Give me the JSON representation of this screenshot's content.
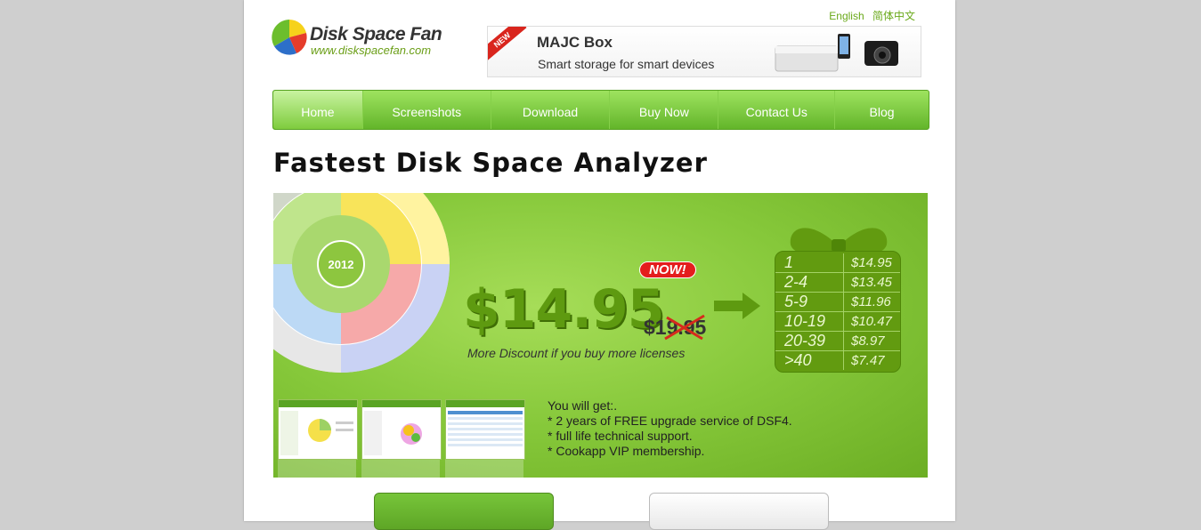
{
  "language": {
    "english": "English",
    "chinese": "简体中文"
  },
  "logo": {
    "name": "Disk Space Fan",
    "url": "www.diskspacefan.com"
  },
  "ad": {
    "badge": "NEW",
    "title": "MAJC  Box",
    "subtitle": "Smart storage for smart devices"
  },
  "nav": [
    "Home",
    "Screenshots",
    "Download",
    "Buy Now",
    "Contact Us",
    "Blog"
  ],
  "headline": "Fastest Disk Space Analyzer",
  "promo": {
    "year": "2012",
    "now_badge": "NOW!",
    "price": "$14.95",
    "old_price": "$19.95",
    "discount_text": "More Discount if you buy more licenses",
    "tiers": [
      {
        "qty": "1",
        "price": "$14.95"
      },
      {
        "qty": "2-4",
        "price": "$13.45"
      },
      {
        "qty": "5-9",
        "price": "$11.96"
      },
      {
        "qty": "10-19",
        "price": "$10.47"
      },
      {
        "qty": "20-39",
        "price": "$8.97"
      },
      {
        "qty": ">40",
        "price": "$7.47"
      }
    ],
    "benefits": [
      "You will get:.",
      "* 2 years of  FREE upgrade service of DSF4.",
      "* full life technical support.",
      "* Cookapp VIP membership."
    ]
  },
  "colors": {
    "brand_green": "#6aa91a",
    "nav_green": "#63b52a",
    "badge_red": "#e41d1d"
  }
}
